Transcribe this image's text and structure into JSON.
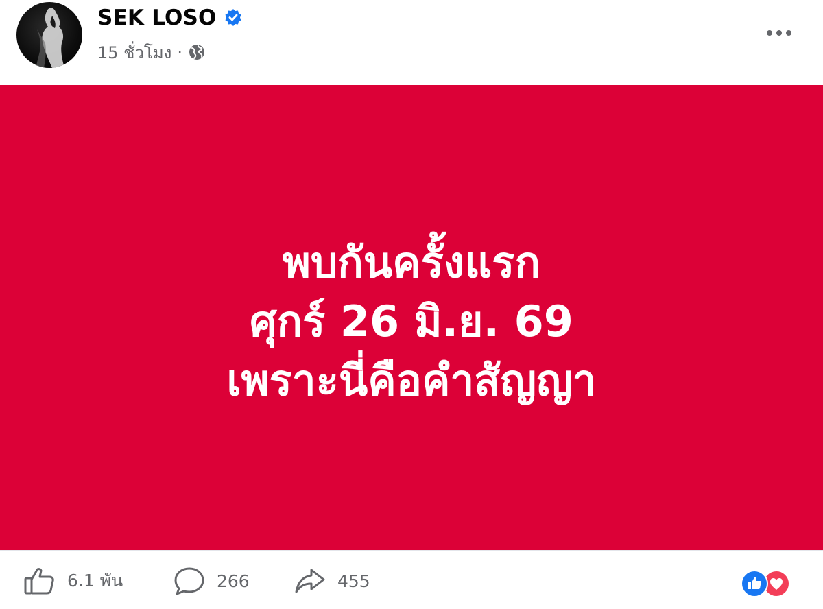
{
  "post": {
    "author": "SEK LOSO",
    "time": "15 ชั่วโมง",
    "separator": "·",
    "card_lines": [
      "พบกันครั้งแรก",
      "ศุกร์ 26 มิ.ย. 69",
      "เพราะนี่คือคำสัญญา"
    ],
    "card_color": "#dc0137"
  },
  "actions": {
    "like_count": "6.1 พัน",
    "comment_count": "266",
    "share_count": "455"
  },
  "icons": {
    "verified": "verified-badge-icon",
    "privacy": "globe-icon",
    "more": "more-options-icon",
    "like": "thumbs-up-icon",
    "comment": "comment-bubble-icon",
    "share": "share-arrow-icon",
    "reaction_like": "like-reaction-icon",
    "reaction_love": "love-reaction-icon"
  },
  "colors": {
    "accent": "#1877f2",
    "love": "#f33e58",
    "text_secondary": "#65676b"
  }
}
